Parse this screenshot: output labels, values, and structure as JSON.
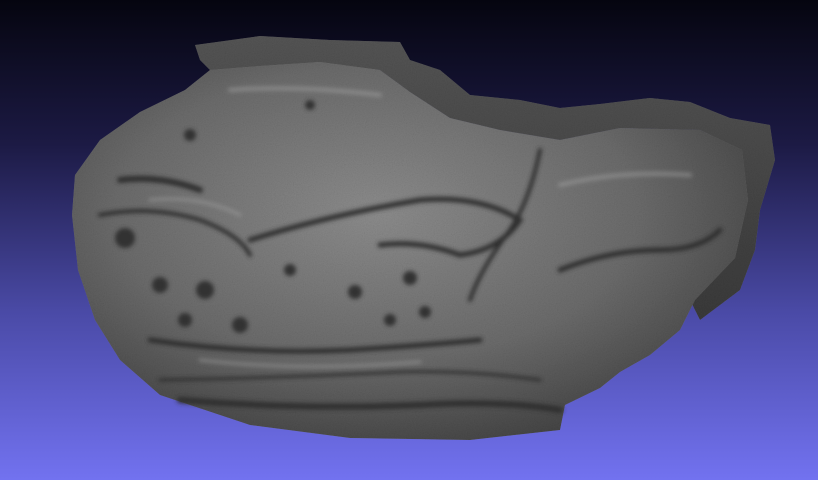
{
  "viewer": {
    "background_top": "#05050f",
    "background_bottom": "#7272f0"
  },
  "model": {
    "subject": "3d-scan-carved-stone-slab",
    "surface_color": "#6a6a6a",
    "rim_color": "#4a4a4a"
  }
}
